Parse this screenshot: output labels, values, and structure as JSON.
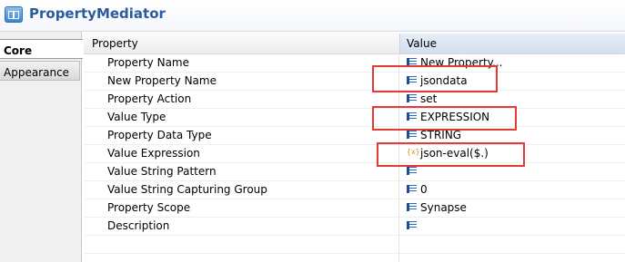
{
  "window": {
    "title": "PropertyMediator",
    "icon": "mediator-icon"
  },
  "tabs": [
    {
      "label": "Core",
      "active": true
    },
    {
      "label": "Appearance",
      "active": false
    }
  ],
  "table": {
    "columns": {
      "property": "Property",
      "value": "Value"
    },
    "rows": [
      {
        "property": "Property Name",
        "value": "New Property...",
        "icon": "list-icon"
      },
      {
        "property": "New Property Name",
        "value": "jsondata",
        "icon": "list-icon"
      },
      {
        "property": "Property Action",
        "value": "set",
        "icon": "list-icon"
      },
      {
        "property": "Value Type",
        "value": "EXPRESSION",
        "icon": "list-icon"
      },
      {
        "property": "Property Data Type",
        "value": "STRING",
        "icon": "list-icon"
      },
      {
        "property": "Value Expression",
        "value": "json-eval($.)",
        "icon": "expression-icon"
      },
      {
        "property": "Value String Pattern",
        "value": "",
        "icon": "list-icon"
      },
      {
        "property": "Value String Capturing Group",
        "value": "0",
        "icon": "list-icon"
      },
      {
        "property": "Property Scope",
        "value": "Synapse",
        "icon": "list-icon"
      },
      {
        "property": "Description",
        "value": "",
        "icon": "list-icon"
      }
    ]
  },
  "colors": {
    "title": "#2b5aa0",
    "highlight": "#e53935",
    "header_value_bg": "#d3dfee"
  }
}
